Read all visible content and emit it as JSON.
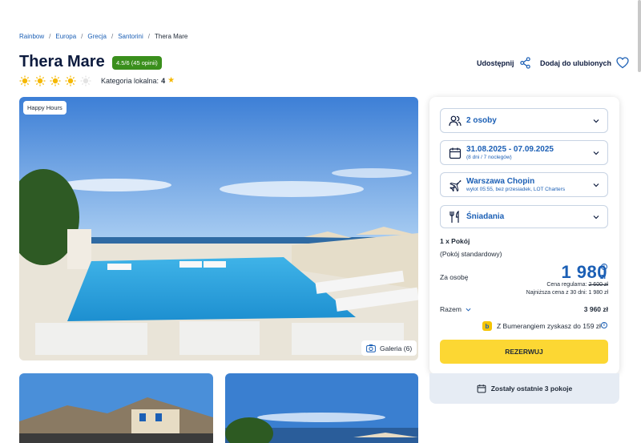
{
  "breadcrumb": [
    "Rainbow",
    "Europa",
    "Grecja",
    "Santorini",
    "Thera Mare"
  ],
  "hotel": {
    "name": "Thera Mare",
    "rating": "4.5/6",
    "reviews": "(45 opinii)",
    "category_label": "Kategoria lokalna:",
    "category_value": "4",
    "suns": 4,
    "suns_max": 5
  },
  "actions": {
    "share": "Udostępnij",
    "favorite": "Dodaj do ulubionych"
  },
  "photo": {
    "badge": "Happy Hours",
    "gallery": "Galeria (6)"
  },
  "booking": {
    "persons": "2 osoby",
    "dates": "31.08.2025 - 07.09.2025",
    "dates_sub": "(8 dni / 7 noclegów)",
    "airport": "Warszawa Chopin",
    "airport_sub": "wylot 05:55, bez przesiadek, LOT Charters",
    "board": "Śniadania",
    "room_count": "1 x Pokój",
    "room_type": "(Pokój standardowy)",
    "per_person_label": "Za osobę",
    "price": "1 980",
    "currency": "zł",
    "regular_label": "Cena regularna:",
    "regular_price": "2 600 zł",
    "lowest_label": "Najniższa cena z 30 dni: 1 980 zł",
    "total_label": "Razem",
    "total_value": "3 960 zł",
    "bumerang": "Z Bumerangiem zyskasz do 159 zł",
    "bumerang_logo": "b",
    "reserve": "REZERWUJ",
    "rooms_left": "Zostały ostatnie 3 pokoje"
  },
  "colors": {
    "accent": "#1b5fb5",
    "rating": "#3a8f1c",
    "cta": "#fcd733",
    "sun": "#f5b800"
  }
}
